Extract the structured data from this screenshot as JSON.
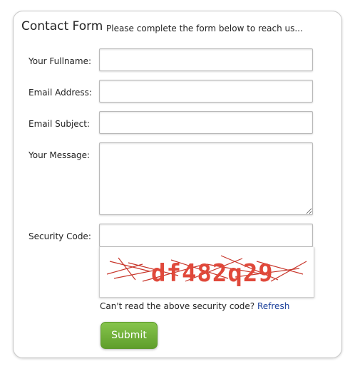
{
  "form": {
    "title": "Contact Form",
    "subtitle": "Please complete the form below to reach us...",
    "fields": {
      "fullname": {
        "label": "Your Fullname:",
        "value": "",
        "placeholder": ""
      },
      "email": {
        "label": "Email Address:",
        "value": "",
        "placeholder": ""
      },
      "subject": {
        "label": "Email Subject:",
        "value": "",
        "placeholder": ""
      },
      "message": {
        "label": "Your Message:",
        "value": "",
        "placeholder": ""
      },
      "security": {
        "label": "Security Code:",
        "value": "",
        "placeholder": ""
      }
    },
    "captcha": {
      "code": "df482q29",
      "note": "Can't read the above security code?",
      "refresh_label": "Refresh",
      "text_color": "#e0483a"
    },
    "submit_label": "Submit",
    "colors": {
      "submit_top": "#86c44c",
      "submit_bottom": "#5f9e2b",
      "link": "#1a3f9a"
    }
  }
}
